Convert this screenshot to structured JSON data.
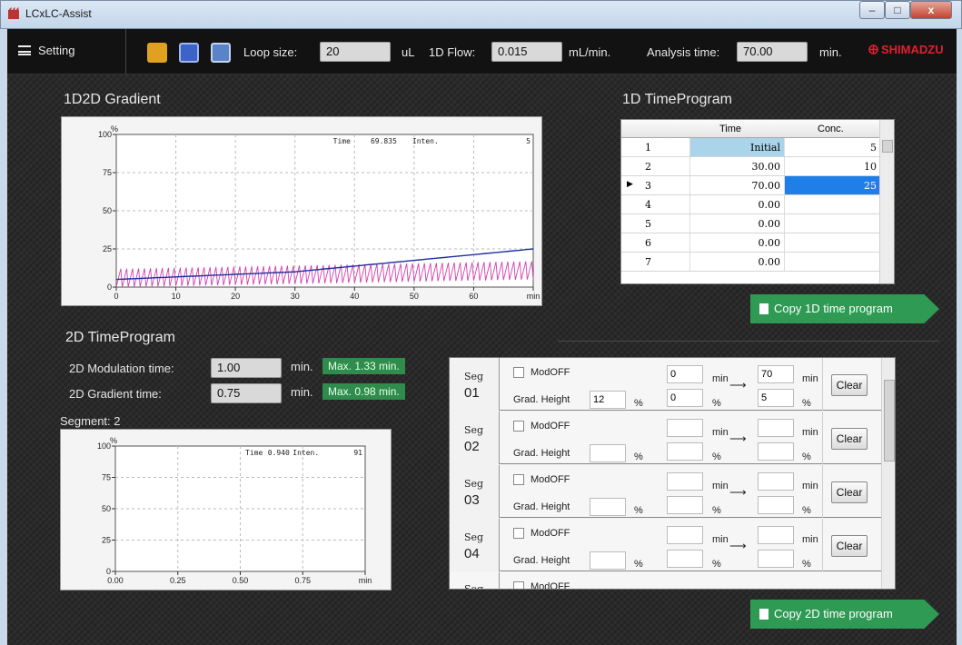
{
  "window": {
    "title": "LCxLC-Assist",
    "min": "–",
    "max": "□",
    "close": "x"
  },
  "toolbar": {
    "setting_label": "Setting",
    "loop_label": "Loop size:",
    "loop_value": "20",
    "loop_unit": "uL",
    "flow_label": "1D Flow:",
    "flow_value": "0.015",
    "flow_unit": "mL/min.",
    "analysis_label": "Analysis time:",
    "analysis_value": "70.00",
    "analysis_unit": "min.",
    "brand": "SHIMADZU"
  },
  "gradient1": {
    "title": "1D2D Gradient",
    "y_unit": "%",
    "y_ticks": [
      "100",
      "75",
      "50",
      "25",
      "0"
    ],
    "x_ticks": [
      "0",
      "10",
      "20",
      "30",
      "40",
      "50",
      "60",
      "min"
    ],
    "readout_time_label": "Time",
    "readout_time": "69.835",
    "readout_inten_label": "Inten.",
    "readout_inten": "5"
  },
  "tp1": {
    "title": "1D TimeProgram",
    "col_time": "Time",
    "col_conc": "Conc.",
    "rows": [
      {
        "n": "1",
        "time": "Initial",
        "conc": "5"
      },
      {
        "n": "2",
        "time": "30.00",
        "conc": "10"
      },
      {
        "n": "3",
        "time": "70.00",
        "conc": "25"
      },
      {
        "n": "4",
        "time": "0.00",
        "conc": ""
      },
      {
        "n": "5",
        "time": "0.00",
        "conc": ""
      },
      {
        "n": "6",
        "time": "0.00",
        "conc": ""
      },
      {
        "n": "7",
        "time": "0.00",
        "conc": ""
      }
    ],
    "copy_label": "Copy 1D time program"
  },
  "tp2": {
    "title": "2D TimeProgram",
    "mod_label": "2D Modulation time:",
    "mod_value": "1.00",
    "mod_unit": "min.",
    "mod_max": "Max. 1.33 min.",
    "grad_label": "2D Gradient time:",
    "grad_value": "0.75",
    "grad_unit": "min.",
    "grad_max": "Max. 0.98 min.",
    "segment_label": "Segment:",
    "segment_value": "2",
    "copy_label": "Copy 2D time program"
  },
  "gradient2": {
    "y_unit": "%",
    "y_ticks": [
      "100",
      "75",
      "50",
      "25",
      "0"
    ],
    "x_ticks": [
      "0.00",
      "0.25",
      "0.50",
      "0.75",
      "min"
    ],
    "readout_time_label": "Time",
    "readout_time": "0.940",
    "readout_inten_label": "Inten.",
    "readout_inten": "91"
  },
  "segments": {
    "seg_label": "Seg",
    "modoff_label": "ModOFF",
    "grad_height_label": "Grad. Height",
    "pct": "%",
    "min": "min",
    "arrow": "⟶",
    "clear_label": "Clear",
    "rows": [
      {
        "num": "01",
        "height": "12",
        "t_start": "0",
        "t_end": "70",
        "c_start": "0",
        "c_end": "5"
      },
      {
        "num": "02",
        "height": "",
        "t_start": "",
        "t_end": "",
        "c_start": "",
        "c_end": ""
      },
      {
        "num": "03",
        "height": "",
        "t_start": "",
        "t_end": "",
        "c_start": "",
        "c_end": ""
      },
      {
        "num": "04",
        "height": "",
        "t_start": "",
        "t_end": "",
        "c_start": "",
        "c_end": ""
      }
    ]
  }
}
